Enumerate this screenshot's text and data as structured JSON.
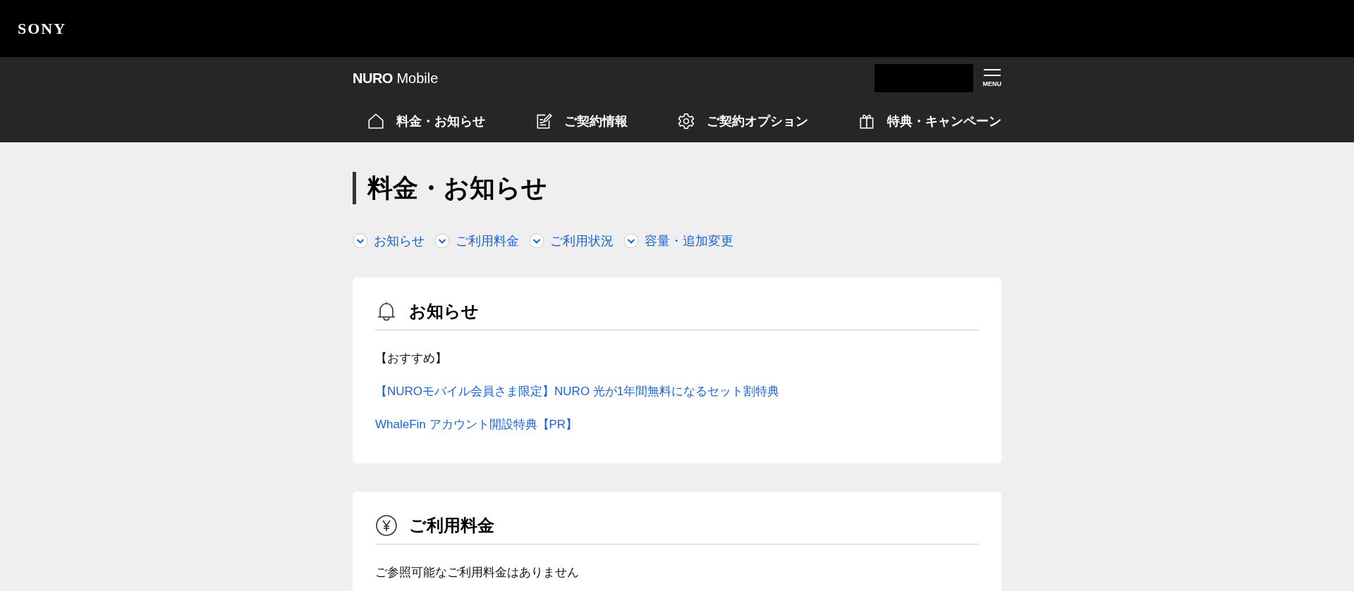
{
  "brand_bar": {
    "logo": "SONY"
  },
  "header": {
    "logo_bold": "NURO",
    "logo_light": "Mobile",
    "menu_label": "MENU"
  },
  "nav": [
    {
      "kind": "home",
      "label": "料金・お知らせ"
    },
    {
      "kind": "edit",
      "label": "ご契約情報"
    },
    {
      "kind": "gear",
      "label": "ご契約オプション"
    },
    {
      "kind": "gift",
      "label": "特典・キャンペーン"
    }
  ],
  "page_title": "料金・お知らせ",
  "anchors": [
    "お知らせ",
    "ご利用料金",
    "ご利用状況",
    "容量・追加変更"
  ],
  "cards": [
    {
      "kind": "bell",
      "title": "お知らせ",
      "items": [
        {
          "kind": "text",
          "text": "【おすすめ】"
        },
        {
          "kind": "link",
          "text": "【NUROモバイル会員さま限定】NURO 光が1年間無料になるセット割特典"
        },
        {
          "kind": "link",
          "text": "WhaleFin アカウント開設特典【PR】"
        }
      ]
    },
    {
      "kind": "yen",
      "title": "ご利用料金",
      "items": [
        {
          "kind": "text",
          "text": "ご参照可能なご利用料金はありません"
        }
      ]
    }
  ]
}
